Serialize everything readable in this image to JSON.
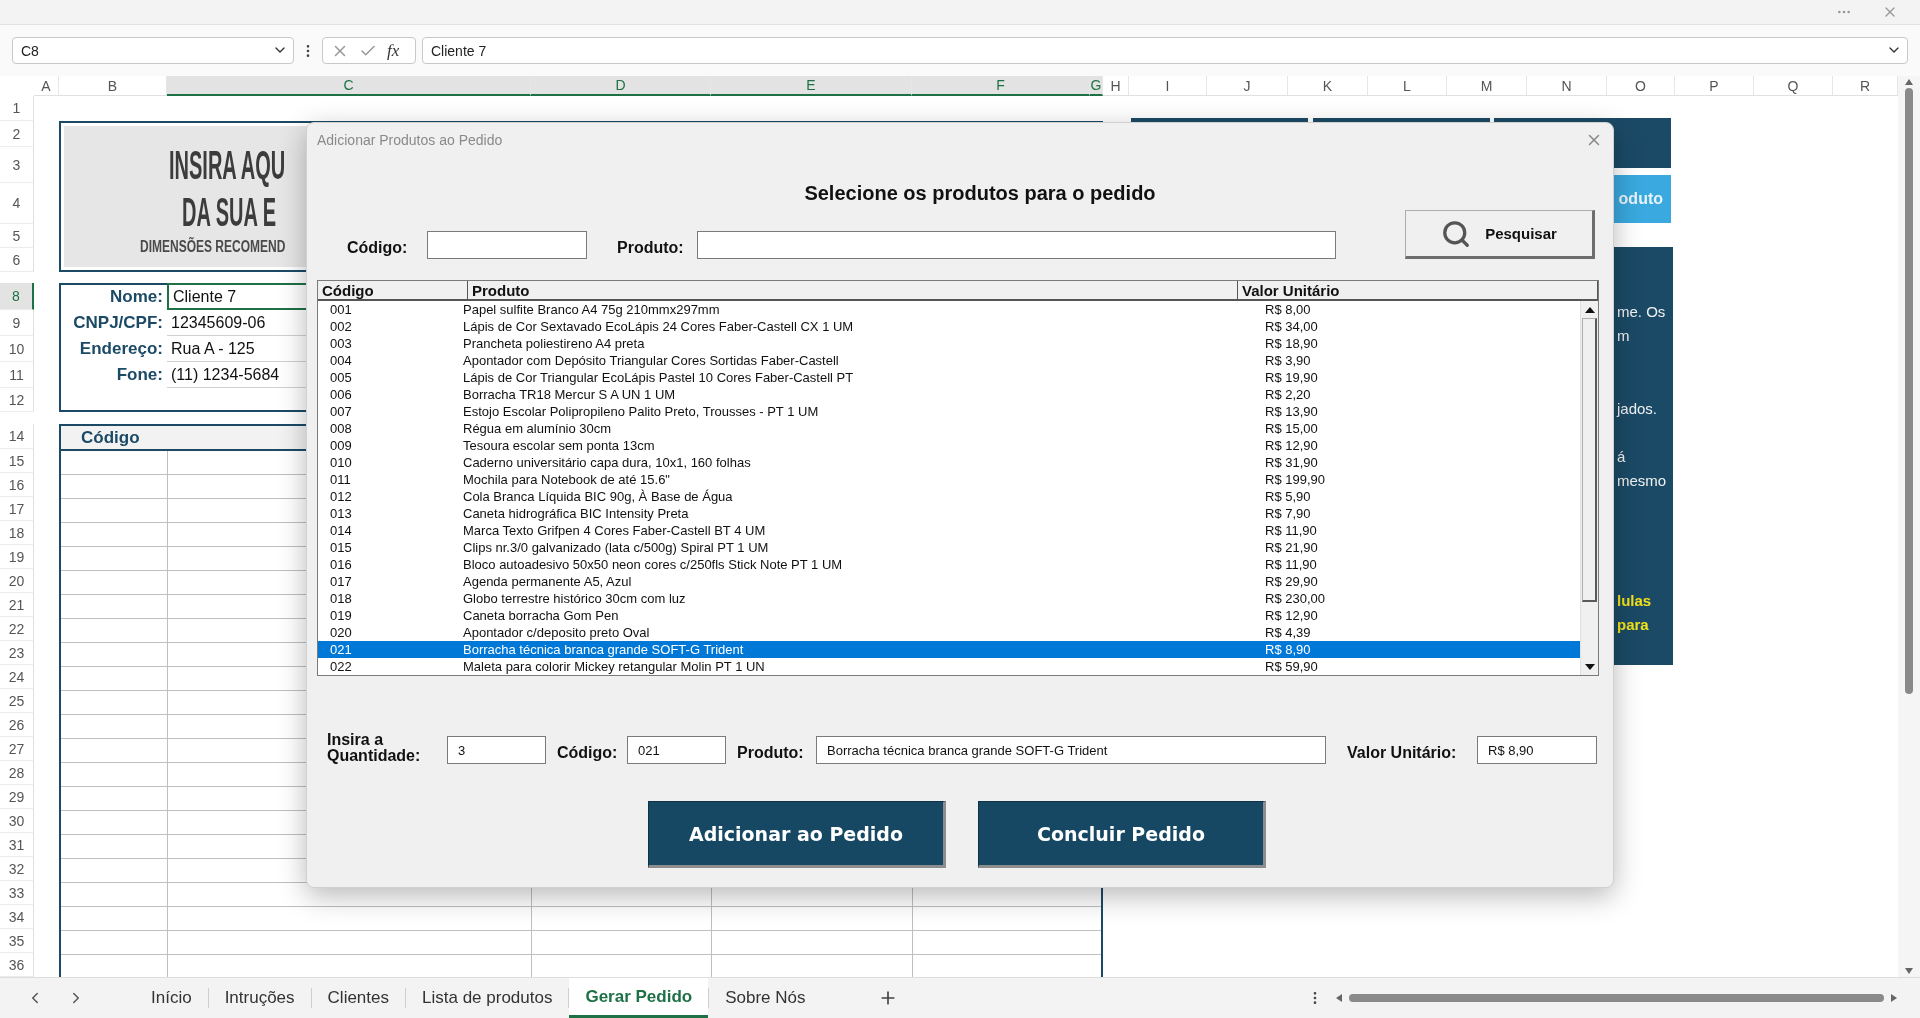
{
  "formula_bar": {
    "name_box": "C8",
    "function_label": "fx",
    "formula": "Cliente 7"
  },
  "sheet": {
    "columns": [
      {
        "label": "A",
        "selected": false
      },
      {
        "label": "B",
        "selected": false
      },
      {
        "label": "C",
        "selected": true
      },
      {
        "label": "D",
        "selected": true
      },
      {
        "label": "E",
        "selected": true
      },
      {
        "label": "F",
        "selected": true
      },
      {
        "label": "G",
        "selected": true
      },
      {
        "label": "H",
        "selected": false
      },
      {
        "label": "I",
        "selected": false
      },
      {
        "label": "J",
        "selected": false
      },
      {
        "label": "K",
        "selected": false
      },
      {
        "label": "L",
        "selected": false
      },
      {
        "label": "M",
        "selected": false
      },
      {
        "label": "N",
        "selected": false
      },
      {
        "label": "O",
        "selected": false
      },
      {
        "label": "P",
        "selected": false
      },
      {
        "label": "Q",
        "selected": false
      },
      {
        "label": "R",
        "selected": false
      }
    ],
    "rows": [
      {
        "label": "1",
        "selected": false
      },
      {
        "label": "2",
        "selected": false
      },
      {
        "label": "3",
        "selected": false
      },
      {
        "label": "4",
        "selected": false
      },
      {
        "label": "5",
        "selected": false
      },
      {
        "label": "6",
        "selected": false
      },
      {
        "label": "8",
        "selected": true
      },
      {
        "label": "9",
        "selected": false
      },
      {
        "label": "10",
        "selected": false
      },
      {
        "label": "11",
        "selected": false
      },
      {
        "label": "12",
        "selected": false
      },
      {
        "label": "14",
        "selected": false
      },
      {
        "label": "15",
        "selected": false
      },
      {
        "label": "16",
        "selected": false
      },
      {
        "label": "17",
        "selected": false
      },
      {
        "label": "18",
        "selected": false
      },
      {
        "label": "19",
        "selected": false
      },
      {
        "label": "20",
        "selected": false
      },
      {
        "label": "21",
        "selected": false
      },
      {
        "label": "22",
        "selected": false
      },
      {
        "label": "23",
        "selected": false
      },
      {
        "label": "24",
        "selected": false
      },
      {
        "label": "25",
        "selected": false
      },
      {
        "label": "26",
        "selected": false
      },
      {
        "label": "27",
        "selected": false
      },
      {
        "label": "28",
        "selected": false
      },
      {
        "label": "29",
        "selected": false
      },
      {
        "label": "30",
        "selected": false
      },
      {
        "label": "31",
        "selected": false
      },
      {
        "label": "32",
        "selected": false
      },
      {
        "label": "33",
        "selected": false
      },
      {
        "label": "34",
        "selected": false
      },
      {
        "label": "35",
        "selected": false
      },
      {
        "label": "36",
        "selected": false
      }
    ],
    "logo": {
      "lines": [
        {
          "text": "INSIRA AQU",
          "kind": "title"
        },
        {
          "text": "DA SUA E",
          "kind": "title"
        },
        {
          "text": "DIMENSÕES RECOMEND",
          "kind": "subtitle"
        }
      ]
    },
    "client": {
      "fields": [
        {
          "label": "Nome:",
          "value": "Cliente 7",
          "selected": true
        },
        {
          "label": "CNPJ/CPF:",
          "value": "12345609-06",
          "selected": false
        },
        {
          "label": "Endereço:",
          "value": "Rua A - 125",
          "selected": false
        },
        {
          "label": "Fone:",
          "value": "(11) 1234-5684",
          "selected": false
        }
      ]
    },
    "order_table": {
      "columns": [
        "Código"
      ]
    },
    "side_panel": {
      "button": "oduto",
      "lines": [
        {
          "text": "me. Os",
          "kind": "note"
        },
        {
          "text": "m",
          "kind": "note"
        },
        {
          "text": "jados.",
          "kind": "note"
        },
        {
          "text": "á",
          "kind": "note"
        },
        {
          "text": "mesmo",
          "kind": "note"
        },
        {
          "text": "lulas",
          "kind": "highlight"
        },
        {
          "text": "para",
          "kind": "highlight"
        }
      ]
    }
  },
  "sheet_tabs": [
    {
      "label": "Início",
      "selected": false
    },
    {
      "label": "Intruções",
      "selected": false
    },
    {
      "label": "Clientes",
      "selected": false
    },
    {
      "label": "Lista de produtos",
      "selected": false
    },
    {
      "label": "Gerar Pedido",
      "selected": true
    },
    {
      "label": "Sobre Nós",
      "selected": false
    }
  ],
  "dialog": {
    "title": "Adicionar Produtos ao Pedido",
    "heading": "Selecione os produtos para o pedido",
    "search": {
      "code_label": "Código:",
      "product_label": "Produto:",
      "button": "Pesquisar"
    },
    "list": {
      "columns": [
        "Código",
        "Produto",
        "Valor Unitário"
      ],
      "rows": [
        {
          "code": "001",
          "product": "Papel sulfite Branco A4 75g 210mmx297mm",
          "price": "R$ 8,00",
          "selected": false
        },
        {
          "code": "002",
          "product": "Lápis de Cor Sextavado EcoLápis 24 Cores Faber-Castell CX 1 UM",
          "price": "R$ 34,00",
          "selected": false
        },
        {
          "code": "003",
          "product": "Prancheta poliestireno A4 preta",
          "price": "R$ 18,90",
          "selected": false
        },
        {
          "code": "004",
          "product": "Apontador com Depósito Triangular Cores Sortidas Faber-Castell",
          "price": "R$ 3,90",
          "selected": false
        },
        {
          "code": "005",
          "product": "Lápis de Cor Triangular EcoLápis Pastel 10 Cores Faber-Castell PT",
          "price": "R$ 19,90",
          "selected": false
        },
        {
          "code": "006",
          "product": "Borracha TR18 Mercur S A UN 1 UM",
          "price": "R$ 2,20",
          "selected": false
        },
        {
          "code": "007",
          "product": "Estojo Escolar Polipropileno Palito Preto, Trousses - PT 1 UM",
          "price": "R$ 13,90",
          "selected": false
        },
        {
          "code": "008",
          "product": "Régua em alumínio 30cm",
          "price": "R$ 15,00",
          "selected": false
        },
        {
          "code": "009",
          "product": "Tesoura escolar sem ponta 13cm",
          "price": "R$ 12,90",
          "selected": false
        },
        {
          "code": "010",
          "product": "Caderno universitário capa dura, 10x1, 160 folhas",
          "price": "R$ 31,90",
          "selected": false
        },
        {
          "code": "011",
          "product": "Mochila para Notebook de até 15.6\"",
          "price": "R$ 199,90",
          "selected": false
        },
        {
          "code": "012",
          "product": "Cola Branca Líquida BIC 90g, À Base de Água",
          "price": "R$ 5,90",
          "selected": false
        },
        {
          "code": "013",
          "product": "Caneta hidrográfica BIC Intensity Preta",
          "price": "R$ 7,90",
          "selected": false
        },
        {
          "code": "014",
          "product": "Marca Texto Grifpen 4 Cores Faber-Castell BT 4 UM",
          "price": "R$ 11,90",
          "selected": false
        },
        {
          "code": "015",
          "product": "Clips nr.3/0 galvanizado (lata c/500g) Spiral PT 1 UM",
          "price": "R$ 21,90",
          "selected": false
        },
        {
          "code": "016",
          "product": "Bloco autoadesivo 50x50 neon cores c/250fls Stick Note PT 1 UM",
          "price": "R$ 11,90",
          "selected": false
        },
        {
          "code": "017",
          "product": "Agenda permanente A5, Azul",
          "price": "R$ 29,90",
          "selected": false
        },
        {
          "code": "018",
          "product": "Globo terrestre histórico 30cm com luz",
          "price": "R$ 230,00",
          "selected": false
        },
        {
          "code": "019",
          "product": "Caneta borracha Gom Pen",
          "price": "R$ 12,90",
          "selected": false
        },
        {
          "code": "020",
          "product": "Apontador c/deposito preto Oval",
          "price": "R$ 4,39",
          "selected": false
        },
        {
          "code": "021",
          "product": "Borracha técnica branca grande SOFT-G Trident",
          "price": "R$ 8,90",
          "selected": true
        },
        {
          "code": "022",
          "product": "Maleta para colorir Mickey retangular Molin PT 1 UN",
          "price": "R$ 59,90",
          "selected": false
        }
      ]
    },
    "entry": {
      "quantity_label": "Insira a Quantidade:",
      "quantity": "3",
      "code_label": "Código:",
      "code": "021",
      "product_label": "Produto:",
      "product": "Borracha técnica branca grande SOFT-G Trident",
      "price_label": "Valor Unitário:",
      "price": "R$ 8,90"
    },
    "buttons": [
      "Adicionar ao Pedido",
      "Concluir Pedido"
    ]
  }
}
